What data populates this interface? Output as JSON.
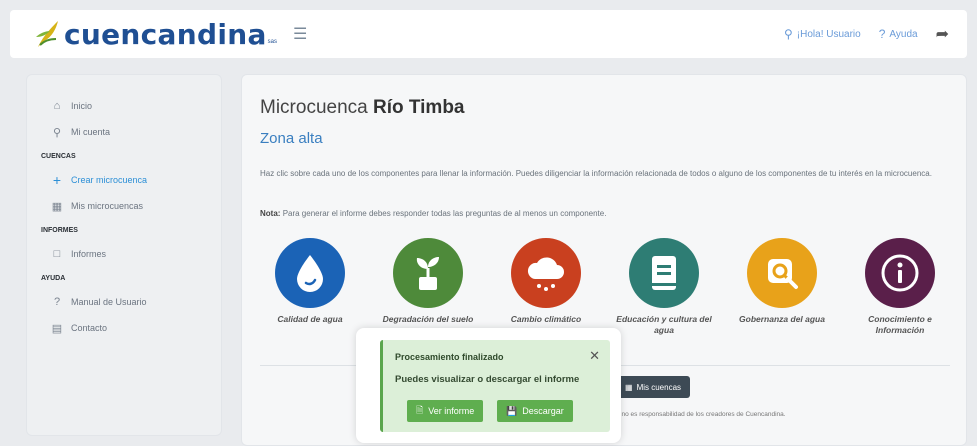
{
  "header": {
    "logo_text": "cuencandina",
    "logo_suffix": "sas",
    "greeting": "¡Hola! Usuario",
    "help": "Ayuda"
  },
  "sidebar": {
    "items": [
      {
        "label": "Inicio",
        "icon": "home-icon"
      },
      {
        "label": "Mi cuenta",
        "icon": "user-icon"
      },
      {
        "section": "CUENCAS"
      },
      {
        "label": "Crear microcuenca",
        "icon": "plus-icon",
        "active": true
      },
      {
        "label": "Mis microcuencas",
        "icon": "database-icon"
      },
      {
        "section": "INFORMES"
      },
      {
        "label": "Informes",
        "icon": "folder-icon"
      },
      {
        "section": "AYUDA"
      },
      {
        "label": "Manual de Usuario",
        "icon": "question-icon"
      },
      {
        "label": "Contacto",
        "icon": "card-icon"
      }
    ]
  },
  "main": {
    "title_prefix": "Microcuenca",
    "title_name": "Río Timba",
    "subtitle": "Zona alta",
    "instructions": "Haz clic sobre cada uno de los componentes para llenar la información. Puedes diligenciar la información relacionada de todos o alguno de los componentes de tu interés en la microcuenca.",
    "note_label": "Nota:",
    "note_text": "Para generar el informe debes responder todas las preguntas de al menos un componente.",
    "components": [
      {
        "label": "Calidad de agua",
        "color": "#1b63b6",
        "icon": "water-drop-icon"
      },
      {
        "label": "Degradación del suelo",
        "color": "#4e8a3a",
        "icon": "plant-icon"
      },
      {
        "label": "Cambio climático",
        "color": "#c9401f",
        "icon": "cloud-rain-icon"
      },
      {
        "label": "Educación y cultura del agua",
        "color": "#2e7d74",
        "icon": "book-icon"
      },
      {
        "label": "Gobernanza del agua",
        "color": "#e8a21a",
        "icon": "magnifier-icon"
      },
      {
        "label": "Conocimiento e Información",
        "color": "#5a1f4a",
        "icon": "info-icon"
      }
    ],
    "my_basins_button": "Mis cuencas",
    "footer_note": "stema no es responsabilidad de los creadores de Cuencandina."
  },
  "toast": {
    "title": "Procesamiento finalizado",
    "message": "Puedes visualizar o descargar el informe",
    "view_button": "Ver informe",
    "download_button": "Descargar"
  },
  "colors": {
    "brand": "#1f4f93",
    "accent": "#2c8fd6",
    "success": "#5fae4f"
  }
}
